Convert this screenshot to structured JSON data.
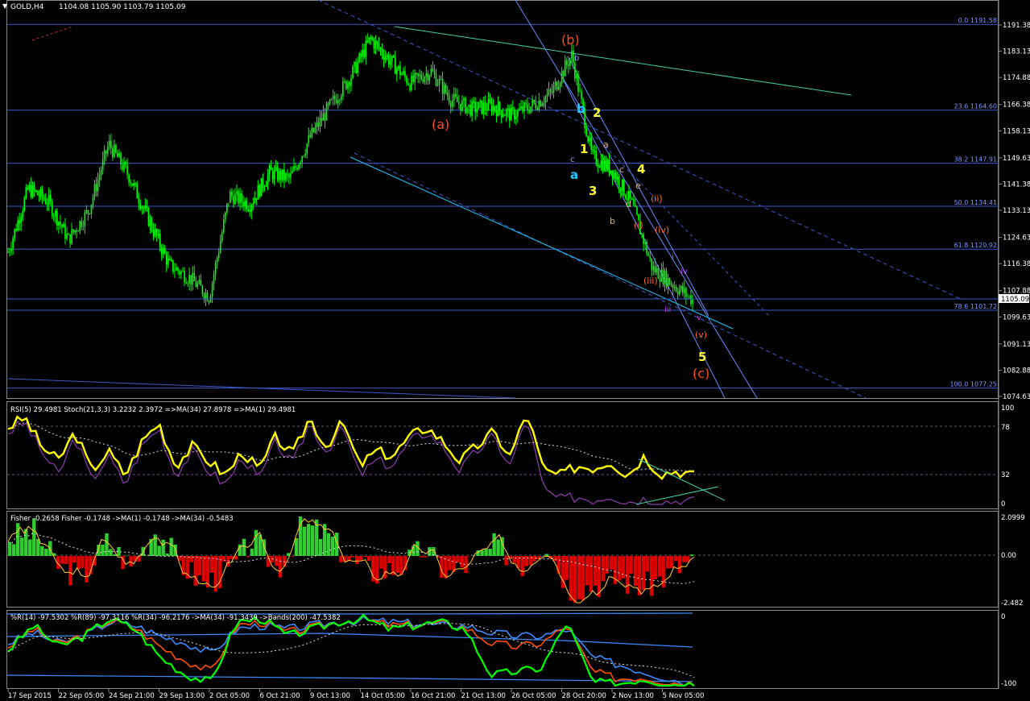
{
  "header": {
    "symbol_tf": "GOLD,H4",
    "ohlc": "1104.08 1105.90 1103.79 1105.09"
  },
  "price_axis": {
    "ticks": [
      "1191.38",
      "1183.13",
      "1174.88",
      "1166.38",
      "1158.13",
      "1149.63",
      "1141.38",
      "1133.13",
      "1124.63",
      "1116.38",
      "1107.88",
      "1099.63",
      "1091.13",
      "1082.88",
      "1074.63"
    ],
    "current_price": "1105.09",
    "range": [
      1072.5,
      1199.5
    ]
  },
  "fib_levels": [
    {
      "label": "0.0 1191.58",
      "price": 1191.58
    },
    {
      "label": "23.6 1164.60",
      "price": 1164.6
    },
    {
      "label": "38.2 1147.91",
      "price": 1147.91
    },
    {
      "label": "50.0 1134.41",
      "price": 1134.41
    },
    {
      "label": "61.8 1120.92",
      "price": 1120.92
    },
    {
      "label": "78.6 1101.72",
      "price": 1101.72
    },
    {
      "label": "100.0 1077.25",
      "price": 1077.25
    }
  ],
  "wave_labels": {
    "a_paren": "(a)",
    "b_paren": "(b)",
    "c_paren": "(c)",
    "blue_a": "a",
    "blue_b": "b",
    "n1": "1",
    "n2": "2",
    "n3": "3",
    "n4": "4",
    "n5": "5",
    "sub_a": "a",
    "sub_b": "b",
    "sub_c": "c",
    "sub_d": "d",
    "sub_e": "e",
    "small_b": "b",
    "small_c": "c",
    "small_v": "v",
    "small_i": "i",
    "r_i": "(i)",
    "r_ii": "(ii)",
    "r_iii": "(iii)",
    "r_iv": "(iv)",
    "r_v": "(v)",
    "p_iii": "iii",
    "p_iv": "iv"
  },
  "panels": {
    "rsi": {
      "title": "RSI(5) 29.4981  Stoch(21,3,3) 3.2232 2.3972  =>MA(34) 27.8978  =>MA(1) 29.4981",
      "scale": [
        "100",
        "78",
        "32",
        "0"
      ]
    },
    "fisher": {
      "title": "Fisher -0.2658  Fisher -0.1748  ->MA(1) -0.1748  ->MA(34) -0.5483",
      "scale": [
        "2.0999",
        "0.00",
        "-2.482"
      ]
    },
    "wpr": {
      "title": "%R(14) -97.5302  %R(89) -97.3116  %R(34) -96.2176  ->MA(34) -91.3439  ->Bands(200) -47.5382",
      "scale": [
        "0",
        "-100"
      ]
    }
  },
  "time_axis": [
    "17 Sep 2015",
    "22 Sep 05:00",
    "24 Sep 21:00",
    "29 Sep 13:00",
    "2 Oct 05:00",
    "6 Oct 21:00",
    "9 Oct 13:00",
    "14 Oct 05:00",
    "16 Oct 21:00",
    "21 Oct 13:00",
    "26 Oct 05:00",
    "28 Oct 20:00",
    "2 Nov 13:00",
    "5 Nov 05:00"
  ],
  "colors": {
    "background": "#000000",
    "bull_candle": "#00ff00",
    "grid": "#5a5a5a",
    "fib": "#3c5ac8",
    "trendline": "#6a8cff",
    "rsi_line": "#ffff00",
    "stoch_line": "#8b3fa8",
    "fisher_pos": "#32cd32",
    "fisher_neg": "#e00000",
    "wpr_fast": "#00ff00",
    "wpr_mid": "#ff5000",
    "wpr_slow": "#3c8cff",
    "orange_label": "#ff4a1a",
    "yellow_label": "#ffff33",
    "cyan_label": "#1ec8ff"
  },
  "chart_data": [
    {
      "type": "candlestick",
      "title": "GOLD,H4",
      "ylim": [
        1072.5,
        1199.5
      ],
      "x_labels": [
        "17 Sep 2015",
        "22 Sep 05:00",
        "24 Sep 21:00",
        "29 Sep 13:00",
        "2 Oct 05:00",
        "6 Oct 21:00",
        "9 Oct 13:00",
        "14 Oct 05:00",
        "16 Oct 21:00",
        "21 Oct 13:00",
        "26 Oct 05:00",
        "28 Oct 20:00",
        "2 Nov 13:00",
        "5 Nov 05:00"
      ],
      "close_path": [
        {
          "x": "17 Sep 2015",
          "y": 1120
        },
        {
          "x": "18 Sep",
          "y": 1140
        },
        {
          "x": "21 Sep",
          "y": 1136
        },
        {
          "x": "22 Sep 05:00",
          "y": 1124
        },
        {
          "x": "23 Sep",
          "y": 1133
        },
        {
          "x": "24 Sep 21:00",
          "y": 1154
        },
        {
          "x": "25 Sep",
          "y": 1144
        },
        {
          "x": "28 Sep",
          "y": 1130
        },
        {
          "x": "29 Sep 13:00",
          "y": 1116
        },
        {
          "x": "1 Oct",
          "y": 1112
        },
        {
          "x": "2 Oct 05:00",
          "y": 1106
        },
        {
          "x": "2 Oct",
          "y": 1138
        },
        {
          "x": "5 Oct",
          "y": 1135
        },
        {
          "x": "6 Oct 21:00",
          "y": 1145
        },
        {
          "x": "8 Oct",
          "y": 1143
        },
        {
          "x": "9 Oct 13:00",
          "y": 1156
        },
        {
          "x": "12 Oct",
          "y": 1166
        },
        {
          "x": "13 Oct",
          "y": 1175
        },
        {
          "x": "14 Oct 05:00",
          "y": 1187
        },
        {
          "x": "15 Oct",
          "y": 1180
        },
        {
          "x": "16 Oct 21:00",
          "y": 1173
        },
        {
          "x": "19 Oct",
          "y": 1177
        },
        {
          "x": "20 Oct",
          "y": 1168
        },
        {
          "x": "21 Oct 13:00",
          "y": 1165
        },
        {
          "x": "22 Oct",
          "y": 1166
        },
        {
          "x": "23 Oct",
          "y": 1163
        },
        {
          "x": "26 Oct 05:00",
          "y": 1166
        },
        {
          "x": "27 Oct",
          "y": 1170
        },
        {
          "x": "28 Oct 20:00",
          "y": 1182
        },
        {
          "x": "29 Oct",
          "y": 1150
        },
        {
          "x": "30 Oct",
          "y": 1146
        },
        {
          "x": "2 Nov 13:00",
          "y": 1135
        },
        {
          "x": "3 Nov",
          "y": 1115
        },
        {
          "x": "4 Nov",
          "y": 1110
        },
        {
          "x": "5 Nov 05:00",
          "y": 1105
        }
      ]
    },
    {
      "type": "line",
      "title": "RSI(5) 29.4981  Stoch(21,3,3) 3.2232 2.3972  =>MA(34) 27.8978  =>MA(1) 29.4981",
      "ylim": [
        0,
        100
      ],
      "series": [
        {
          "name": "RSI(5)",
          "values": [
            80,
            90,
            60,
            45,
            75,
            35,
            55,
            30,
            65,
            85,
            40,
            60,
            45,
            30,
            55,
            35,
            70,
            50,
            90,
            60,
            85,
            40,
            55,
            50,
            70,
            80,
            65,
            45,
            60,
            75,
            50,
            95,
            35,
            30,
            40,
            38,
            45,
            30,
            50,
            32,
            35,
            29.5
          ]
        },
        {
          "name": "Stoch(21,3,3)",
          "values": [
            75,
            85,
            55,
            30,
            70,
            25,
            50,
            20,
            60,
            80,
            30,
            55,
            35,
            20,
            50,
            25,
            65,
            40,
            85,
            55,
            80,
            30,
            45,
            40,
            65,
            75,
            60,
            35,
            55,
            70,
            40,
            90,
            15,
            5,
            8,
            5,
            10,
            3,
            6,
            3,
            4,
            3.2
          ]
        }
      ]
    },
    {
      "type": "bar",
      "title": "Fisher -0.2658  Fisher -0.1748  ->MA(1) -0.1748  ->MA(34) -0.5483",
      "ylim": [
        -2.482,
        2.0999
      ],
      "values": [
        1.0,
        1.3,
        -0.5,
        -1.2,
        0.8,
        -0.6,
        1.5,
        -0.4,
        -1.5,
        -0.8,
        0.9,
        -0.7,
        1.6,
        1.2,
        -0.3,
        -0.9,
        -0.6,
        0.4,
        -1.0,
        -0.3,
        0.6,
        -0.5,
        0.8,
        -1.8,
        -1.5,
        -1.2,
        -1.7,
        -1.0,
        -0.2
      ]
    },
    {
      "type": "line",
      "title": "%R(14) -97.5302  %R(89) -97.3116  %R(34) -96.2176  ->MA(34) -91.3439  ->Bands(200) -47.5382",
      "ylim": [
        -100,
        0
      ],
      "series": [
        {
          "name": "%R(14)",
          "values": [
            -50,
            -15,
            -45,
            -30,
            -5,
            -20,
            -60,
            -85,
            -95,
            -10,
            -5,
            -30,
            -20,
            -10,
            -5,
            -20,
            -15,
            -10,
            -20,
            -85,
            -80,
            -75,
            -10,
            -95,
            -97,
            -90,
            -98,
            -97.5
          ]
        },
        {
          "name": "%R(89)",
          "values": [
            -40,
            -25,
            -40,
            -30,
            -10,
            -15,
            -30,
            -40,
            -55,
            -20,
            -15,
            -20,
            -15,
            -10,
            -8,
            -10,
            -12,
            -15,
            -15,
            -25,
            -30,
            -30,
            -20,
            -60,
            -70,
            -80,
            -90,
            -97.3
          ]
        },
        {
          "name": "%R(34)",
          "values": [
            -45,
            -20,
            -42,
            -28,
            -8,
            -18,
            -45,
            -65,
            -80,
            -15,
            -10,
            -25,
            -18,
            -10,
            -6,
            -15,
            -14,
            -12,
            -18,
            -40,
            -45,
            -40,
            -15,
            -80,
            -90,
            -88,
            -95,
            -96.2
          ]
        }
      ]
    }
  ]
}
